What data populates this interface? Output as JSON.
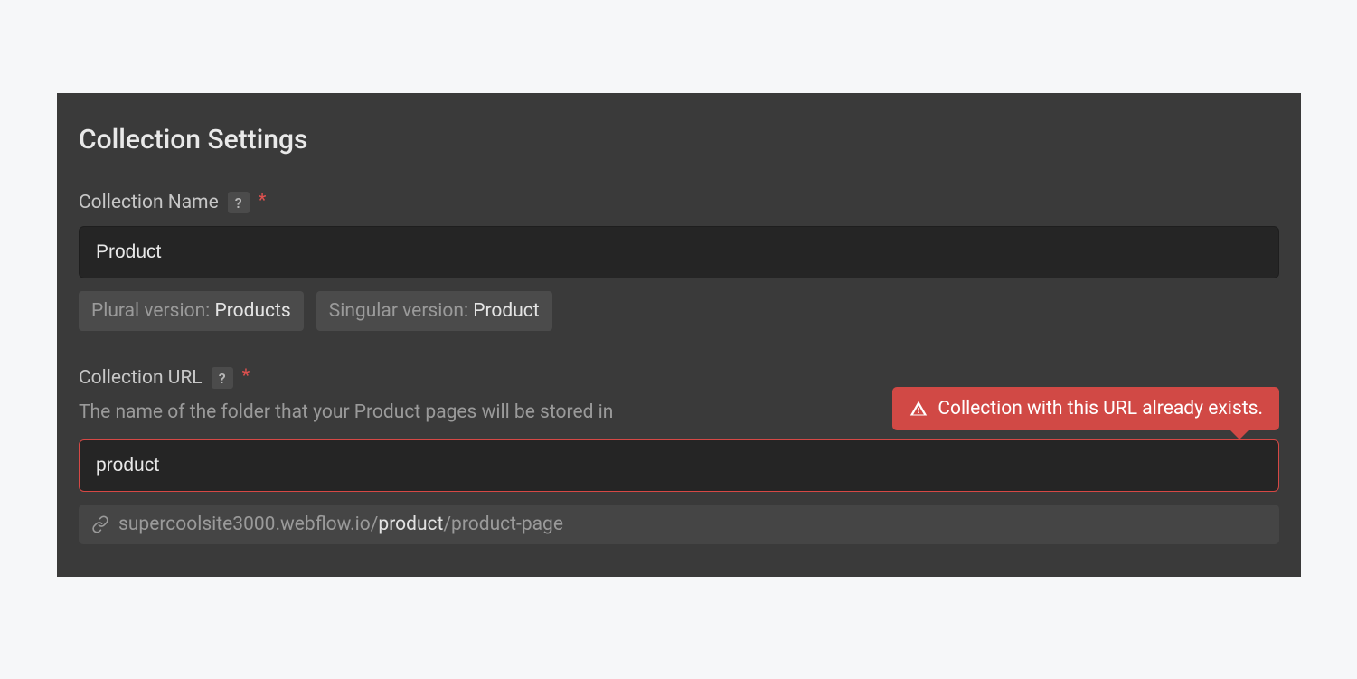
{
  "title": "Collection Settings",
  "name_field": {
    "label": "Collection Name",
    "help": "?",
    "required_mark": "*",
    "value": "Product"
  },
  "plural_chip": {
    "prefix": "Plural version: ",
    "value": "Products"
  },
  "singular_chip": {
    "prefix": "Singular version: ",
    "value": "Product"
  },
  "url_field": {
    "label": "Collection URL",
    "help": "?",
    "required_mark": "*",
    "hint": "The name of the folder that your Product pages will be stored in",
    "value": "product",
    "error": "Collection with this URL already exists."
  },
  "url_preview": {
    "prefix": "supercoolsite3000.webflow.io/",
    "slug": "product",
    "suffix": "/product-page"
  }
}
